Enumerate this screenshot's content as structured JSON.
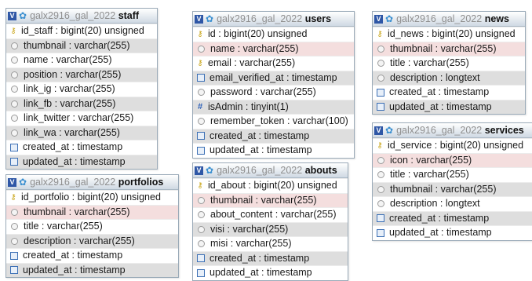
{
  "db_name": "galx2916_gal_2022",
  "separator": " ",
  "check_glyph": "V",
  "gear_glyph": "✿",
  "tables": {
    "staff": {
      "name": "staff",
      "columns": [
        {
          "text": "id_staff : bigint(20) unsigned",
          "icon": "key",
          "bg": "white"
        },
        {
          "text": "thumbnail : varchar(255)",
          "icon": "col",
          "bg": "alt"
        },
        {
          "text": "name : varchar(255)",
          "icon": "col",
          "bg": "white"
        },
        {
          "text": "position : varchar(255)",
          "icon": "col",
          "bg": "alt"
        },
        {
          "text": "link_ig : varchar(255)",
          "icon": "col",
          "bg": "white"
        },
        {
          "text": "link_fb : varchar(255)",
          "icon": "col",
          "bg": "alt"
        },
        {
          "text": "link_twitter : varchar(255)",
          "icon": "col",
          "bg": "white"
        },
        {
          "text": "link_wa : varchar(255)",
          "icon": "col",
          "bg": "alt"
        },
        {
          "text": "created_at : timestamp",
          "icon": "time",
          "bg": "white"
        },
        {
          "text": "updated_at : timestamp",
          "icon": "time",
          "bg": "alt"
        }
      ]
    },
    "users": {
      "name": "users",
      "columns": [
        {
          "text": "id : bigint(20) unsigned",
          "icon": "key",
          "bg": "white"
        },
        {
          "text": "name : varchar(255)",
          "icon": "col",
          "bg": "hl"
        },
        {
          "text": "email : varchar(255)",
          "icon": "key",
          "bg": "white"
        },
        {
          "text": "email_verified_at : timestamp",
          "icon": "time",
          "bg": "alt"
        },
        {
          "text": "password : varchar(255)",
          "icon": "col",
          "bg": "white"
        },
        {
          "text": "isAdmin : tinyint(1)",
          "icon": "num",
          "bg": "alt"
        },
        {
          "text": "remember_token : varchar(100)",
          "icon": "col",
          "bg": "white"
        },
        {
          "text": "created_at : timestamp",
          "icon": "time",
          "bg": "alt"
        },
        {
          "text": "updated_at : timestamp",
          "icon": "time",
          "bg": "white"
        }
      ]
    },
    "news": {
      "name": "news",
      "columns": [
        {
          "text": "id_news : bigint(20) unsigned",
          "icon": "key",
          "bg": "white"
        },
        {
          "text": "thumbnail : varchar(255)",
          "icon": "col",
          "bg": "hl"
        },
        {
          "text": "title : varchar(255)",
          "icon": "col",
          "bg": "white"
        },
        {
          "text": "description : longtext",
          "icon": "col",
          "bg": "alt"
        },
        {
          "text": "created_at : timestamp",
          "icon": "time",
          "bg": "white"
        },
        {
          "text": "updated_at : timestamp",
          "icon": "time",
          "bg": "alt"
        }
      ]
    },
    "services": {
      "name": "services",
      "columns": [
        {
          "text": "id_service : bigint(20) unsigned",
          "icon": "key",
          "bg": "white"
        },
        {
          "text": "icon : varchar(255)",
          "icon": "col",
          "bg": "hl"
        },
        {
          "text": "title : varchar(255)",
          "icon": "col",
          "bg": "white"
        },
        {
          "text": "thumbnail : varchar(255)",
          "icon": "col",
          "bg": "alt"
        },
        {
          "text": "description : longtext",
          "icon": "col",
          "bg": "white"
        },
        {
          "text": "created_at : timestamp",
          "icon": "time",
          "bg": "alt"
        },
        {
          "text": "updated_at : timestamp",
          "icon": "time",
          "bg": "white"
        }
      ]
    },
    "portfolios": {
      "name": "portfolios",
      "columns": [
        {
          "text": "id_portfolio : bigint(20) unsigned",
          "icon": "key",
          "bg": "white"
        },
        {
          "text": "thumbnail : varchar(255)",
          "icon": "col",
          "bg": "hl"
        },
        {
          "text": "title : varchar(255)",
          "icon": "col",
          "bg": "white"
        },
        {
          "text": "description : varchar(255)",
          "icon": "col",
          "bg": "alt"
        },
        {
          "text": "created_at : timestamp",
          "icon": "time",
          "bg": "white"
        },
        {
          "text": "updated_at : timestamp",
          "icon": "time",
          "bg": "alt"
        }
      ]
    },
    "abouts": {
      "name": "abouts",
      "columns": [
        {
          "text": "id_about : bigint(20) unsigned",
          "icon": "key",
          "bg": "white"
        },
        {
          "text": "thumbnail : varchar(255)",
          "icon": "col",
          "bg": "hl"
        },
        {
          "text": "about_content : varchar(255)",
          "icon": "col",
          "bg": "white"
        },
        {
          "text": "visi : varchar(255)",
          "icon": "col",
          "bg": "alt"
        },
        {
          "text": "misi : varchar(255)",
          "icon": "col",
          "bg": "white"
        },
        {
          "text": "created_at : timestamp",
          "icon": "time",
          "bg": "alt"
        },
        {
          "text": "updated_at : timestamp",
          "icon": "time",
          "bg": "white"
        }
      ]
    }
  }
}
